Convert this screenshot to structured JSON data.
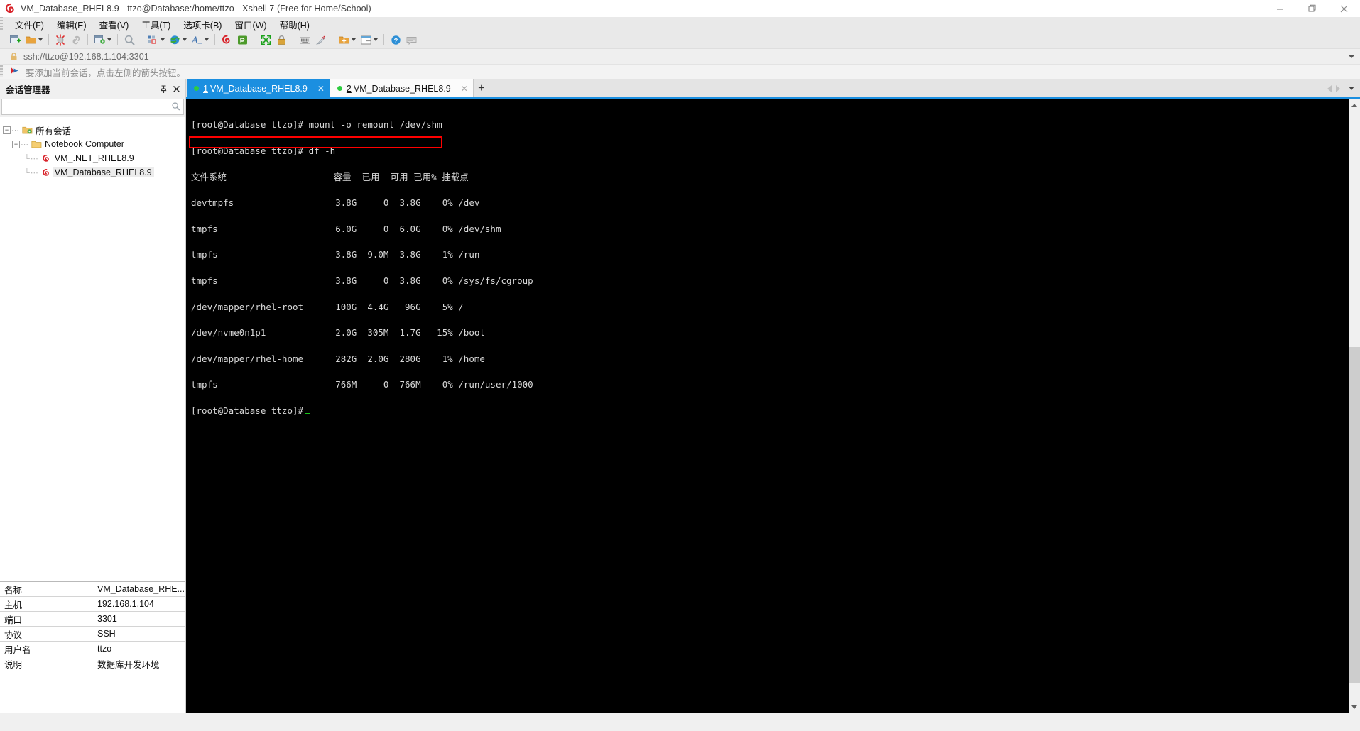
{
  "window": {
    "title": "VM_Database_RHEL8.9 - ttzo@Database:/home/ttzo - Xshell 7 (Free for Home/School)",
    "logo_icon": "xshell-logo-icon",
    "minimize_label": "—",
    "restore_label": "❐",
    "close_label": "✕"
  },
  "menubar": {
    "items": [
      {
        "label": "文件(F)",
        "name": "menu-file"
      },
      {
        "label": "编辑(E)",
        "name": "menu-edit"
      },
      {
        "label": "查看(V)",
        "name": "menu-view"
      },
      {
        "label": "工具(T)",
        "name": "menu-tools"
      },
      {
        "label": "选项卡(B)",
        "name": "menu-tabs"
      },
      {
        "label": "窗口(W)",
        "name": "menu-window"
      },
      {
        "label": "帮助(H)",
        "name": "menu-help"
      }
    ]
  },
  "toolbar": {
    "items": [
      {
        "icon": "new-session-icon",
        "has_arrow": false
      },
      {
        "icon": "open-folder-icon",
        "has_arrow": true
      },
      {
        "sep": true
      },
      {
        "icon": "disconnect-icon",
        "has_arrow": false
      },
      {
        "icon": "reconnect-icon",
        "has_arrow": false
      },
      {
        "sep": true
      },
      {
        "icon": "session-properties-icon",
        "has_arrow": true
      },
      {
        "sep": true
      },
      {
        "icon": "find-icon",
        "has_arrow": false
      },
      {
        "sep": true
      },
      {
        "icon": "layout-icon",
        "has_arrow": true
      },
      {
        "icon": "globe-transfer-icon",
        "has_arrow": true
      },
      {
        "icon": "font-icon",
        "has_arrow": true
      },
      {
        "sep": true
      },
      {
        "icon": "xshell-icon",
        "has_arrow": false
      },
      {
        "icon": "xftp-icon",
        "has_arrow": false
      },
      {
        "sep": true
      },
      {
        "icon": "fullscreen-icon",
        "has_arrow": false
      },
      {
        "icon": "lock-icon",
        "has_arrow": false
      },
      {
        "sep": true
      },
      {
        "icon": "keyboard-icon",
        "has_arrow": false
      },
      {
        "icon": "highlight-icon",
        "has_arrow": false
      },
      {
        "sep": true
      },
      {
        "icon": "add-folder-icon",
        "has_arrow": true
      },
      {
        "icon": "split-view-icon",
        "has_arrow": true
      },
      {
        "sep": true
      },
      {
        "icon": "help-icon",
        "has_arrow": false
      },
      {
        "icon": "chat-icon",
        "has_arrow": false
      }
    ]
  },
  "addressbar": {
    "lock_icon": "lock-icon",
    "value": "ssh://ttzo@192.168.1.104:3301",
    "dropdown_icon": "chevron-down-icon"
  },
  "hintbar": {
    "icon": "add-arrow-icon",
    "text": "要添加当前会话，点击左侧的箭头按钮。"
  },
  "session_manager": {
    "title": "会话管理器",
    "pin_icon": "pin-icon",
    "close_icon": "close-icon",
    "search": {
      "value": "",
      "placeholder": "",
      "icon": "search-icon"
    },
    "tree": [
      {
        "label": "所有会话",
        "level": 0,
        "icon": "folder-gear-icon",
        "expanded": true,
        "selected": false
      },
      {
        "label": "Notebook Computer",
        "level": 1,
        "icon": "folder-icon",
        "expanded": true,
        "selected": false
      },
      {
        "label": "VM_.NET_RHEL8.9",
        "level": 2,
        "icon": "xshell-session-icon",
        "expanded": null,
        "selected": false
      },
      {
        "label": "VM_Database_RHEL8.9",
        "level": 2,
        "icon": "xshell-session-icon",
        "expanded": null,
        "selected": true
      }
    ],
    "properties": [
      {
        "key": "名称",
        "value": "VM_Database_RHE..."
      },
      {
        "key": "主机",
        "value": "192.168.1.104"
      },
      {
        "key": "端口",
        "value": "3301"
      },
      {
        "key": "协议",
        "value": "SSH"
      },
      {
        "key": "用户名",
        "value": "ttzo"
      },
      {
        "key": "说明",
        "value": "数据库开发环境"
      }
    ]
  },
  "tabs": {
    "items": [
      {
        "number": "1",
        "label": "VM_Database_RHEL8.9",
        "active": true,
        "status_color": "#2ecc40",
        "close_label": "✕"
      },
      {
        "number": "2",
        "label": "VM_Database_RHEL8.9",
        "active": false,
        "status_color": "#2ecc40",
        "close_label": "✕"
      }
    ],
    "add_label": "+",
    "nav_prev_icon": "chevron-left-icon",
    "nav_next_icon": "chevron-right-icon",
    "nav_menu_icon": "chevron-down-icon"
  },
  "terminal": {
    "accent_color": "#1b8fe0",
    "background": "#000000",
    "foreground": "#d8d8d8",
    "highlight_color": "#ff0000",
    "lines": [
      "[root@Database ttzo]# mount -o remount /dev/shm",
      "[root@Database ttzo]# df -h",
      "文件系统                    容量  已用  可用 已用% 挂载点",
      "devtmpfs                   3.8G     0  3.8G    0% /dev",
      "tmpfs                      6.0G     0  6.0G    0% /dev/shm",
      "tmpfs                      3.8G  9.0M  3.8G    1% /run",
      "tmpfs                      3.8G     0  3.8G    0% /sys/fs/cgroup",
      "/dev/mapper/rhel-root      100G  4.4G   96G    5% /",
      "/dev/nvme0n1p1             2.0G  305M  1.7G   15% /boot",
      "/dev/mapper/rhel-home      282G  2.0G  280G    1% /home",
      "tmpfs                      766M     0  766M    0% /run/user/1000"
    ],
    "prompt": "[root@Database ttzo]#",
    "cursor": "block-cursor",
    "highlighted_line_index": 4,
    "scrollbar": {
      "up_icon": "scroll-up-icon",
      "down_icon": "scroll-down-icon"
    }
  }
}
